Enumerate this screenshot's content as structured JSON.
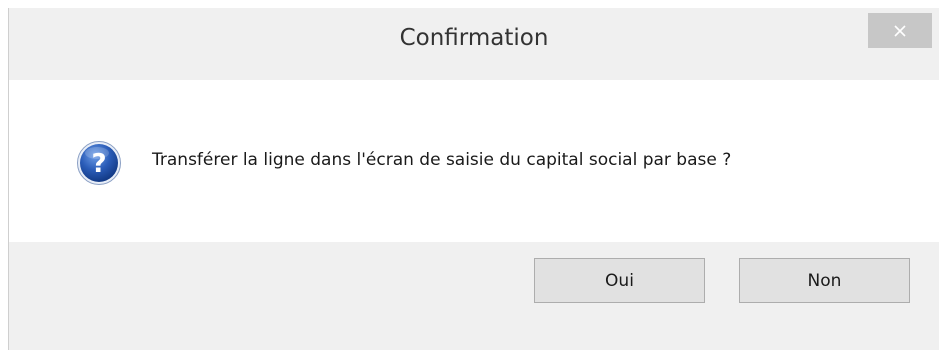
{
  "dialog": {
    "title": "Confirmation",
    "message": "Transférer la ligne dans l'écran de saisie du capital social par base ?",
    "icon": "question-icon",
    "close_icon": "close-icon",
    "buttons": {
      "yes_label": "Oui",
      "no_label": "Non"
    }
  },
  "colors": {
    "title_bar": "#f0f0f0",
    "content_bg": "#ffffff",
    "close_button": "#c7c7c7",
    "button_bg": "#e1e1e1",
    "icon_blue": "#1e4fa8"
  }
}
